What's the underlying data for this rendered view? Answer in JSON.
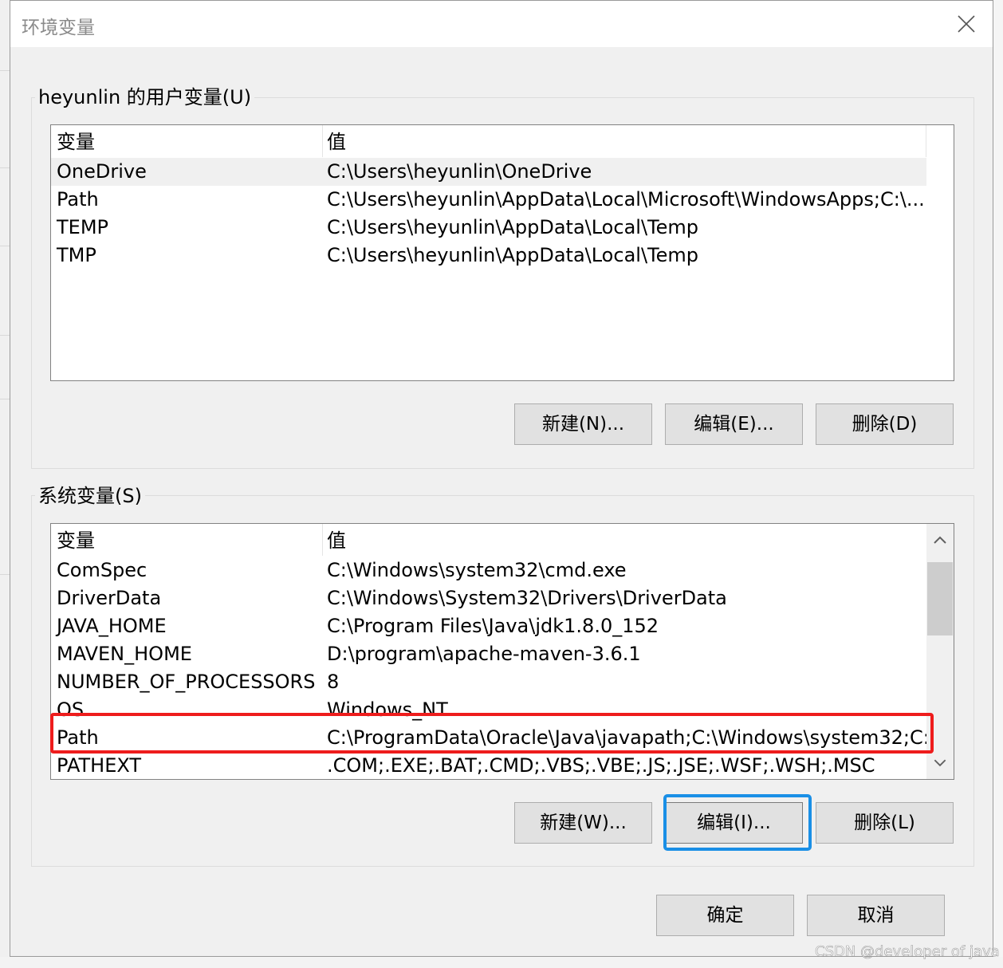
{
  "window": {
    "title": "环境变量"
  },
  "user_vars": {
    "group_label": "heyunlin 的用户变量(U)",
    "headers": {
      "name": "变量",
      "value": "值"
    },
    "rows": [
      {
        "name": "OneDrive",
        "value": "C:\\Users\\heyunlin\\OneDrive",
        "selected": true
      },
      {
        "name": "Path",
        "value": "C:\\Users\\heyunlin\\AppData\\Local\\Microsoft\\WindowsApps;C:\\..."
      },
      {
        "name": "TEMP",
        "value": "C:\\Users\\heyunlin\\AppData\\Local\\Temp"
      },
      {
        "name": "TMP",
        "value": "C:\\Users\\heyunlin\\AppData\\Local\\Temp"
      }
    ],
    "buttons": {
      "new": "新建(N)...",
      "edit": "编辑(E)...",
      "delete": "删除(D)"
    }
  },
  "system_vars": {
    "group_label": "系统变量(S)",
    "headers": {
      "name": "变量",
      "value": "值"
    },
    "rows": [
      {
        "name": "ComSpec",
        "value": "C:\\Windows\\system32\\cmd.exe"
      },
      {
        "name": "DriverData",
        "value": "C:\\Windows\\System32\\Drivers\\DriverData"
      },
      {
        "name": "JAVA_HOME",
        "value": "C:\\Program Files\\Java\\jdk1.8.0_152"
      },
      {
        "name": "MAVEN_HOME",
        "value": "D:\\program\\apache-maven-3.6.1"
      },
      {
        "name": "NUMBER_OF_PROCESSORS",
        "value": "8"
      },
      {
        "name": "OS",
        "value": "Windows_NT"
      },
      {
        "name": "Path",
        "value": "C:\\ProgramData\\Oracle\\Java\\javapath;C:\\Windows\\system32;C:..."
      },
      {
        "name": "PATHEXT",
        "value": ".COM;.EXE;.BAT;.CMD;.VBS;.VBE;.JS;.JSE;.WSF;.WSH;.MSC"
      }
    ],
    "buttons": {
      "new": "新建(W)...",
      "edit": "编辑(I)...",
      "delete": "删除(L)"
    }
  },
  "footer": {
    "ok": "确定",
    "cancel": "取消"
  },
  "watermark": "CSDN @developer of java",
  "annotation_colors": {
    "red_box": "#ee1c1c",
    "blue_box": "#1a8fe6"
  }
}
